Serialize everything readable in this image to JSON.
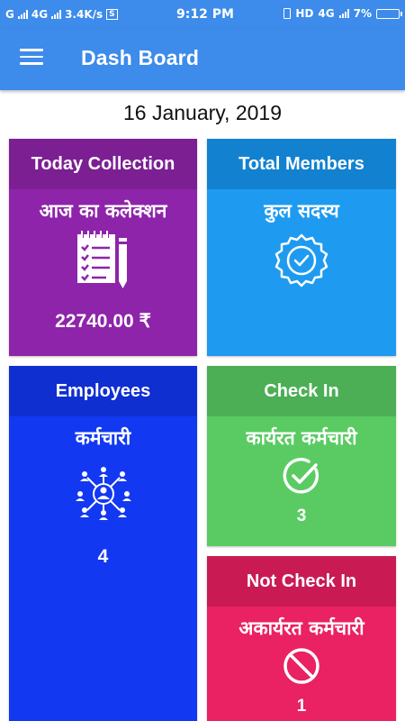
{
  "status_bar": {
    "carrier_left": "G",
    "network_type": "4G",
    "speed": "3.4K/s",
    "time": "9:12 PM",
    "hd_label": "HD",
    "network_type_right": "4G",
    "battery": "7%"
  },
  "app_bar": {
    "title": "Dash Board",
    "menu_icon": "hamburger-menu-icon"
  },
  "date": "16 January, 2019",
  "cards": {
    "collection": {
      "title": "Today Collection",
      "subtitle": "आज का कलेक्शन",
      "value": "22740.00 ₹",
      "icon": "notepad-checklist-icon",
      "color": "#8e24aa"
    },
    "members": {
      "title": "Total Members",
      "subtitle": "कुल सदस्य",
      "icon": "verified-badge-icon",
      "color": "#1e9bf0"
    },
    "employees": {
      "title": "Employees",
      "subtitle": "कर्मचारी",
      "value": "4",
      "icon": "people-network-icon",
      "color": "#1338f2"
    },
    "checkin": {
      "title": "Check In",
      "subtitle": "कार्यरत कर्मचारी",
      "value": "3",
      "icon": "check-circle-icon",
      "color": "#5acb63"
    },
    "notcheckin": {
      "title": "Not Check In",
      "subtitle": "अकार्यरत कर्मचारी",
      "value": "1",
      "icon": "block-icon",
      "color": "#ea2163"
    }
  }
}
